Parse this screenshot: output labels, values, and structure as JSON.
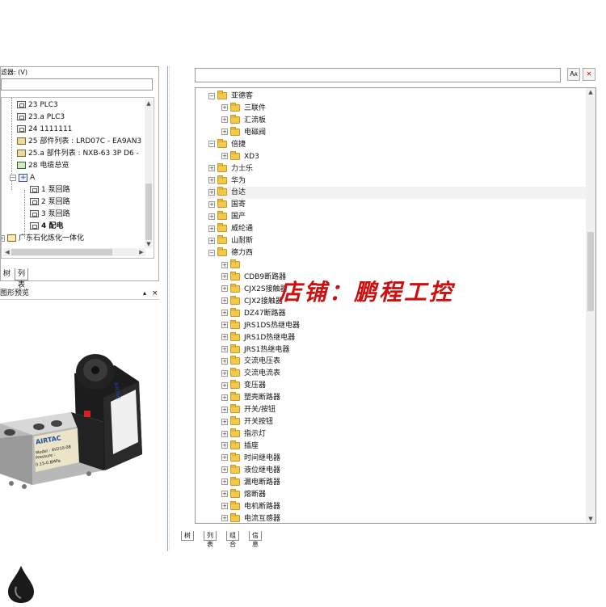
{
  "left_panel": {
    "filter_label": "滤器: (V)",
    "tree": [
      {
        "label": "23 PLC3",
        "icon": "page-icon"
      },
      {
        "label": "23.a PLC3",
        "icon": "page-icon"
      },
      {
        "label": "24 1111111",
        "icon": "page-icon"
      },
      {
        "label": "25 部件列表 : LRD07C - EA9AN3",
        "icon": "parts-list-icon"
      },
      {
        "label": "25.a 部件列表 : NXB-63 3P D6 -",
        "icon": "parts-list-icon"
      },
      {
        "label": "28 电缆总览",
        "icon": "cable-overview-icon"
      },
      {
        "label": "A",
        "icon": "structure-icon"
      },
      {
        "label": "1 泵回路",
        "icon": "page-icon"
      },
      {
        "label": "2 泵回路",
        "icon": "page-icon"
      },
      {
        "label": "3 泵回路",
        "icon": "page-icon"
      },
      {
        "label": "4 配电",
        "icon": "page-icon"
      },
      {
        "label": "广东石化炼化一体化",
        "icon": "project-icon"
      }
    ],
    "tabs": [
      "树",
      "列表"
    ],
    "preview_title": "图形预览",
    "preview_buttons": [
      "▴",
      "×"
    ]
  },
  "right_panel": {
    "toolbar": [
      "🗛",
      "✕"
    ],
    "tree": [
      {
        "label": "亚德客",
        "level": 0,
        "expanded": true
      },
      {
        "label": "三联件",
        "level": 1,
        "expanded": false
      },
      {
        "label": "汇流板",
        "level": 1,
        "expanded": false
      },
      {
        "label": "电磁阀",
        "level": 1,
        "expanded": false
      },
      {
        "label": "倍捷",
        "level": 0,
        "expanded": true
      },
      {
        "label": "XD3",
        "level": 1,
        "expanded": false
      },
      {
        "label": "力士乐",
        "level": 0,
        "expanded": false
      },
      {
        "label": "华为",
        "level": 0,
        "expanded": false
      },
      {
        "label": "台达",
        "level": 0,
        "expanded": false
      },
      {
        "label": "国寄",
        "level": 0,
        "expanded": false
      },
      {
        "label": "国产",
        "level": 0,
        "expanded": false
      },
      {
        "label": "威纶通",
        "level": 0,
        "expanded": false
      },
      {
        "label": "山耐斯",
        "level": 0,
        "expanded": false
      },
      {
        "label": "德力西",
        "level": 0,
        "expanded": true
      },
      {
        "label": "",
        "level": 1,
        "expanded": false
      },
      {
        "label": "CDB9断路器",
        "level": 1,
        "expanded": false
      },
      {
        "label": "CJX2S接触器",
        "level": 1,
        "expanded": false
      },
      {
        "label": "CJX2接触器",
        "level": 1,
        "expanded": false
      },
      {
        "label": "DZ47断路器",
        "level": 1,
        "expanded": false
      },
      {
        "label": "JRS1DS热继电器",
        "level": 1,
        "expanded": false
      },
      {
        "label": "JRS1D热继电器",
        "level": 1,
        "expanded": false
      },
      {
        "label": "JRS1热继电器",
        "level": 1,
        "expanded": false
      },
      {
        "label": "交流电压表",
        "level": 1,
        "expanded": false
      },
      {
        "label": "交流电流表",
        "level": 1,
        "expanded": false
      },
      {
        "label": "变压器",
        "level": 1,
        "expanded": false
      },
      {
        "label": "塑壳断路器",
        "level": 1,
        "expanded": false
      },
      {
        "label": "开关/按钮",
        "level": 1,
        "expanded": false
      },
      {
        "label": "开关按钮",
        "level": 1,
        "expanded": false
      },
      {
        "label": "指示灯",
        "level": 1,
        "expanded": false
      },
      {
        "label": "插座",
        "level": 1,
        "expanded": false
      },
      {
        "label": "时间继电器",
        "level": 1,
        "expanded": false
      },
      {
        "label": "液位继电器",
        "level": 1,
        "expanded": false
      },
      {
        "label": "漏电断路器",
        "level": 1,
        "expanded": false
      },
      {
        "label": "熔断器",
        "level": 1,
        "expanded": false
      },
      {
        "label": "电机断路器",
        "level": 1,
        "expanded": false
      },
      {
        "label": "电流互感器",
        "level": 1,
        "expanded": false
      }
    ],
    "tabs": [
      "树",
      "列表",
      "组合",
      "信息"
    ]
  },
  "watermark": "店铺：鹏程工控",
  "product": {
    "brand": "AIRTAC",
    "model": "4V210-08",
    "label_text": [
      "Model : 4V210-08",
      "Pressure :",
      "0.15-0.8MPa"
    ]
  }
}
